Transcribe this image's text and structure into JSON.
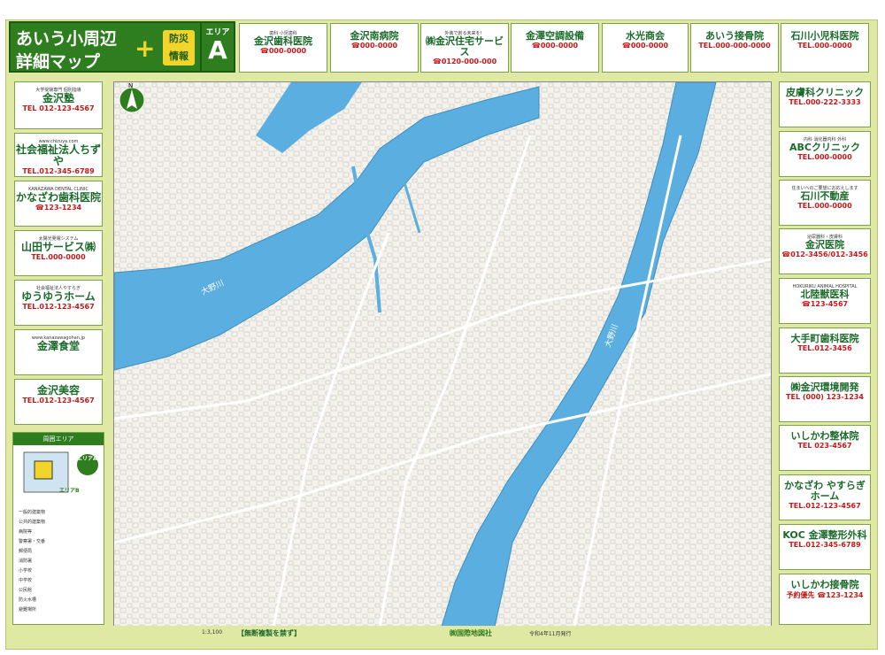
{
  "header": {
    "title_line1": "あいう小周辺",
    "title_line2": "詳細マップ",
    "plus": "+",
    "bousai": "防災\n情報",
    "area_label": "エリア",
    "area_letter": "A"
  },
  "top_ads": [
    {
      "name": "ad-kanazawa-dental",
      "title": "金沢歯科医院",
      "sub": "歯科 小児歯科",
      "tel": "☎000-0000"
    },
    {
      "name": "ad-kanazawa-hospital",
      "title": "金沢南病院",
      "sub": "",
      "tel": "☎000-0000"
    },
    {
      "name": "ad-kanazawa-living",
      "title": "㈱金沢住宅サービス",
      "sub": "外装で創る未来を！",
      "tel": "☎0120-000-000"
    },
    {
      "name": "ad-kanazawa-aircon",
      "title": "金澤空調設備",
      "sub": "",
      "tel": "☎000-0000"
    },
    {
      "name": "ad-suiko",
      "title": "水光商会",
      "sub": "",
      "tel": "☎000-0000"
    },
    {
      "name": "ad-aiu-bonesetter",
      "title": "あいう接骨院",
      "sub": "",
      "tel": "TEL.000-000-0000"
    },
    {
      "name": "ad-ishikawa-pediatric",
      "title": "石川小児科医院",
      "sub": "",
      "tel": "TEL.000-0000"
    }
  ],
  "left_ads": [
    {
      "name": "ad-kanazawa-juku",
      "title": "金沢塾",
      "sub": "大学受験専門 個別指導",
      "tel": "TEL 012-123-4567"
    },
    {
      "name": "ad-chizuya",
      "title": "社会福祉法人ちずや",
      "sub": "www.chizuya.com",
      "tel": "TEL.012-345-6789"
    },
    {
      "name": "ad-kanazawa-dental-left",
      "title": "かなざわ歯科医院",
      "sub": "KANAZAWA DENTAL CLINIC",
      "tel": "☎123-1234"
    },
    {
      "name": "ad-yamada",
      "title": "山田サービス㈱",
      "sub": "太陽光発電システム",
      "tel": "TEL.000-0000"
    },
    {
      "name": "ad-yuyu-home",
      "title": "ゆうゆうホーム",
      "sub": "社会福祉法人やすらぎ",
      "tel": "TEL.012-123-4567"
    },
    {
      "name": "ad-kanazawa-shokudo",
      "title": "金澤食堂",
      "sub": "www.kanazawagohan.jp",
      "tel": ""
    },
    {
      "name": "ad-kanazawa-biyou",
      "title": "金沢美容",
      "sub": "",
      "tel": "TEL.012-123-4567"
    }
  ],
  "right_ads": [
    {
      "name": "ad-hifuka-clinic",
      "title": "皮膚科クリニック",
      "sub": "",
      "tel": "TEL.000-222-3333"
    },
    {
      "name": "ad-abc-clinic",
      "title": "ABCクリニック",
      "sub": "内科 消化器内科 外科",
      "tel": "TEL.000-0000"
    },
    {
      "name": "ad-ishikawa-fudousan",
      "title": "石川不動産",
      "sub": "住まいへのご要望にお応えします",
      "tel": "TEL.000-0000"
    },
    {
      "name": "ad-kanazawa-iin",
      "title": "金沢医院",
      "sub": "泌尿器科・皮膚科",
      "tel": "☎012-3456/012-3456"
    },
    {
      "name": "ad-hokuriku-vet",
      "title": "北陸獣医科",
      "sub": "HOKURIKU ANIMAL HOSPITAL",
      "tel": "☎123-4567"
    },
    {
      "name": "ad-otemachi-dental",
      "title": "大手町歯科医院",
      "sub": "",
      "tel": "TEL.012-3456"
    },
    {
      "name": "ad-kk-kanazawa-env",
      "title": "㈱金沢環境開発",
      "sub": "",
      "tel": "TEL (000) 123-1234"
    },
    {
      "name": "ad-ishikawa-seitai",
      "title": "いしかわ整体院",
      "sub": "",
      "tel": "TEL 023-4567"
    },
    {
      "name": "ad-yasuragi-home",
      "title": "かなざわ やすらぎホーム",
      "sub": "",
      "tel": "TEL.012-123-4567"
    },
    {
      "name": "ad-koc-seikei",
      "title": "KOC 金澤整形外科",
      "sub": "",
      "tel": "TEL.012-345-6789"
    },
    {
      "name": "ad-ishikawa-sekkotsu",
      "title": "いしかわ接骨院",
      "sub": "",
      "tel": "予約優先 ☎123-1234"
    }
  ],
  "legend": {
    "title": "周囲エリア",
    "area_badge": "エリアA",
    "area_b": "エリアB",
    "items": [
      "一般的建築物",
      "公共的建築物",
      "病院等",
      "警察署・交番",
      "郵便局",
      "消防署",
      "小学校",
      "中学校",
      "公民館",
      "防火水槽",
      "避難場所"
    ]
  },
  "map": {
    "river_label_1": "大野川",
    "river_label_2": "大野川",
    "north_label": "N"
  },
  "bottom": {
    "scale": "1:3,100",
    "notice": "【無断複製を禁ず】",
    "publisher": "㈱国際地図社",
    "issue": "令和4年11月発行"
  }
}
